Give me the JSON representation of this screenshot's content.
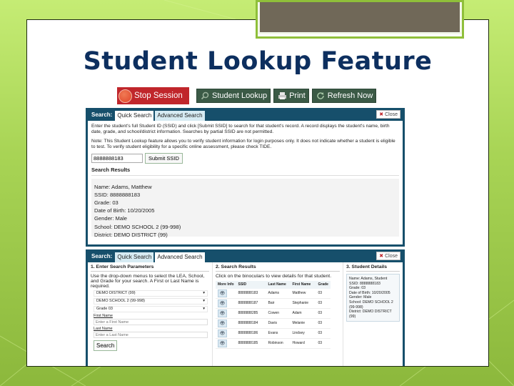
{
  "slide": {
    "title": "Student Lookup Feature"
  },
  "toolbar": {
    "stop_session": "Stop Session",
    "student_lookup": "Student Lookup",
    "print": "Print",
    "refresh_now": "Refresh Now"
  },
  "quick_panel": {
    "header_label": "Search:",
    "tabs": [
      "Quick Search",
      "Advanced Search"
    ],
    "close": "Close",
    "instructions": "Enter the student's full Student ID (SSID) and click [Submit SSID] to search for that student's record. A record displays the student's name, birth date, grade, and school/district information. Searches by partial SSID are not permitted.",
    "note": "Note: This Student Lookup feature allows you to verify student information for login purposes only. It does not indicate whether a student is eligible to test. To verify student eligibility for a specific online assessment, please check TIDE.",
    "ssid_value": "8888888183",
    "submit_label": "Submit SSID",
    "results_title": "Search Results",
    "result_lines": [
      "Name: Adams, Matthew",
      "SSID: 8888888183",
      "Grade: 03",
      "Date of Birth: 10/20/2005",
      "Gender: Male",
      "School: DEMO SCHOOL 2 (99-998)",
      "District: DEMO DISTRICT (99)"
    ]
  },
  "advanced_panel": {
    "header_label": "Search:",
    "tabs": [
      "Quick Search",
      "Advanced Search"
    ],
    "close": "Close",
    "col1": {
      "title": "1. Enter Search Parameters",
      "instructions": "Use the drop-down menus to select the LEA, School, and Grade for your search. A First or Last Name is required.",
      "selects": [
        "DEMO DISTRICT (99)",
        "DEMO SCHOOL 2 (99-998)",
        "Grade 03"
      ],
      "first_name_label": "First Name",
      "first_name_placeholder": "Enter a First Name",
      "last_name_label": "Last Name",
      "last_name_placeholder": "Enter a Last Name",
      "search_label": "Search"
    },
    "col2": {
      "title": "2. Search Results",
      "instructions": "Click on the binoculars to view details for that student.",
      "headers": [
        "More Info",
        "SSID",
        "Last Name",
        "First Name",
        "Grade"
      ],
      "rows": [
        {
          "ssid": "8888888183",
          "last": "Adams",
          "first": "Matthew",
          "grade": "03"
        },
        {
          "ssid": "8888888187",
          "last": "Bair",
          "first": "Stephanie",
          "grade": "03"
        },
        {
          "ssid": "8888888285",
          "last": "Cowen",
          "first": "Adam",
          "grade": "03"
        },
        {
          "ssid": "8888888184",
          "last": "Davis",
          "first": "Melanie",
          "grade": "03"
        },
        {
          "ssid": "8888888186",
          "last": "Evans",
          "first": "Lindsey",
          "grade": "03"
        },
        {
          "ssid": "8888888185",
          "last": "Robinson",
          "first": "Howard",
          "grade": "03"
        }
      ]
    },
    "col3": {
      "title": "3. Student Details",
      "lines": [
        "Name: Adams, Student",
        "SSID: 8888888183",
        "Grade: 03",
        "Date of Birth: 10/20/2005",
        "Gender: Male",
        "School: DEMO SCHOOL 2 (99-998)",
        "District: DEMO DISTRICT (99)"
      ]
    }
  },
  "colors": {
    "title": "#0d2f5f",
    "panel_header": "#164f6b",
    "stop_button": "#c0262b",
    "toolbar_button": "#3b5a46",
    "background_green": "#a8d455"
  }
}
